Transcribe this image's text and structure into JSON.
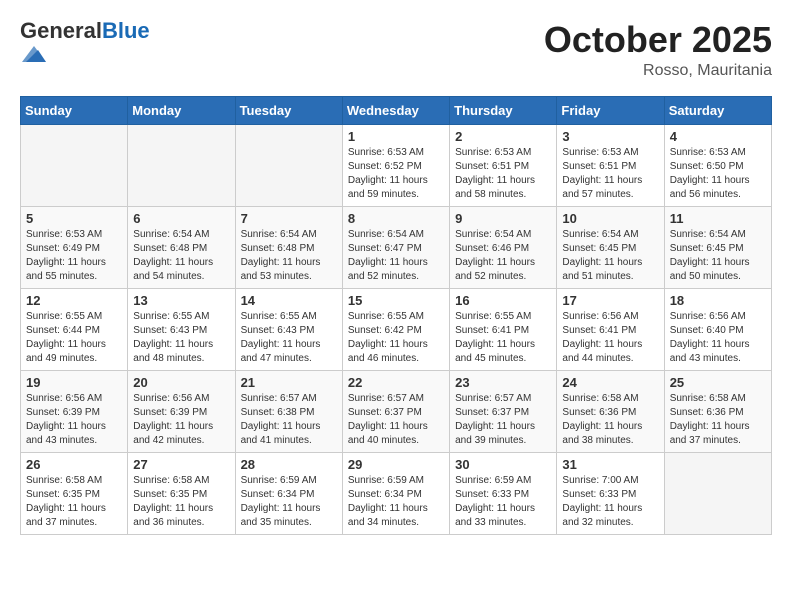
{
  "logo": {
    "general": "General",
    "blue": "Blue"
  },
  "header": {
    "month": "October 2025",
    "location": "Rosso, Mauritania"
  },
  "weekdays": [
    "Sunday",
    "Monday",
    "Tuesday",
    "Wednesday",
    "Thursday",
    "Friday",
    "Saturday"
  ],
  "weeks": [
    [
      {
        "day": "",
        "info": ""
      },
      {
        "day": "",
        "info": ""
      },
      {
        "day": "",
        "info": ""
      },
      {
        "day": "1",
        "info": "Sunrise: 6:53 AM\nSunset: 6:52 PM\nDaylight: 11 hours\nand 59 minutes."
      },
      {
        "day": "2",
        "info": "Sunrise: 6:53 AM\nSunset: 6:51 PM\nDaylight: 11 hours\nand 58 minutes."
      },
      {
        "day": "3",
        "info": "Sunrise: 6:53 AM\nSunset: 6:51 PM\nDaylight: 11 hours\nand 57 minutes."
      },
      {
        "day": "4",
        "info": "Sunrise: 6:53 AM\nSunset: 6:50 PM\nDaylight: 11 hours\nand 56 minutes."
      }
    ],
    [
      {
        "day": "5",
        "info": "Sunrise: 6:53 AM\nSunset: 6:49 PM\nDaylight: 11 hours\nand 55 minutes."
      },
      {
        "day": "6",
        "info": "Sunrise: 6:54 AM\nSunset: 6:48 PM\nDaylight: 11 hours\nand 54 minutes."
      },
      {
        "day": "7",
        "info": "Sunrise: 6:54 AM\nSunset: 6:48 PM\nDaylight: 11 hours\nand 53 minutes."
      },
      {
        "day": "8",
        "info": "Sunrise: 6:54 AM\nSunset: 6:47 PM\nDaylight: 11 hours\nand 52 minutes."
      },
      {
        "day": "9",
        "info": "Sunrise: 6:54 AM\nSunset: 6:46 PM\nDaylight: 11 hours\nand 52 minutes."
      },
      {
        "day": "10",
        "info": "Sunrise: 6:54 AM\nSunset: 6:45 PM\nDaylight: 11 hours\nand 51 minutes."
      },
      {
        "day": "11",
        "info": "Sunrise: 6:54 AM\nSunset: 6:45 PM\nDaylight: 11 hours\nand 50 minutes."
      }
    ],
    [
      {
        "day": "12",
        "info": "Sunrise: 6:55 AM\nSunset: 6:44 PM\nDaylight: 11 hours\nand 49 minutes."
      },
      {
        "day": "13",
        "info": "Sunrise: 6:55 AM\nSunset: 6:43 PM\nDaylight: 11 hours\nand 48 minutes."
      },
      {
        "day": "14",
        "info": "Sunrise: 6:55 AM\nSunset: 6:43 PM\nDaylight: 11 hours\nand 47 minutes."
      },
      {
        "day": "15",
        "info": "Sunrise: 6:55 AM\nSunset: 6:42 PM\nDaylight: 11 hours\nand 46 minutes."
      },
      {
        "day": "16",
        "info": "Sunrise: 6:55 AM\nSunset: 6:41 PM\nDaylight: 11 hours\nand 45 minutes."
      },
      {
        "day": "17",
        "info": "Sunrise: 6:56 AM\nSunset: 6:41 PM\nDaylight: 11 hours\nand 44 minutes."
      },
      {
        "day": "18",
        "info": "Sunrise: 6:56 AM\nSunset: 6:40 PM\nDaylight: 11 hours\nand 43 minutes."
      }
    ],
    [
      {
        "day": "19",
        "info": "Sunrise: 6:56 AM\nSunset: 6:39 PM\nDaylight: 11 hours\nand 43 minutes."
      },
      {
        "day": "20",
        "info": "Sunrise: 6:56 AM\nSunset: 6:39 PM\nDaylight: 11 hours\nand 42 minutes."
      },
      {
        "day": "21",
        "info": "Sunrise: 6:57 AM\nSunset: 6:38 PM\nDaylight: 11 hours\nand 41 minutes."
      },
      {
        "day": "22",
        "info": "Sunrise: 6:57 AM\nSunset: 6:37 PM\nDaylight: 11 hours\nand 40 minutes."
      },
      {
        "day": "23",
        "info": "Sunrise: 6:57 AM\nSunset: 6:37 PM\nDaylight: 11 hours\nand 39 minutes."
      },
      {
        "day": "24",
        "info": "Sunrise: 6:58 AM\nSunset: 6:36 PM\nDaylight: 11 hours\nand 38 minutes."
      },
      {
        "day": "25",
        "info": "Sunrise: 6:58 AM\nSunset: 6:36 PM\nDaylight: 11 hours\nand 37 minutes."
      }
    ],
    [
      {
        "day": "26",
        "info": "Sunrise: 6:58 AM\nSunset: 6:35 PM\nDaylight: 11 hours\nand 37 minutes."
      },
      {
        "day": "27",
        "info": "Sunrise: 6:58 AM\nSunset: 6:35 PM\nDaylight: 11 hours\nand 36 minutes."
      },
      {
        "day": "28",
        "info": "Sunrise: 6:59 AM\nSunset: 6:34 PM\nDaylight: 11 hours\nand 35 minutes."
      },
      {
        "day": "29",
        "info": "Sunrise: 6:59 AM\nSunset: 6:34 PM\nDaylight: 11 hours\nand 34 minutes."
      },
      {
        "day": "30",
        "info": "Sunrise: 6:59 AM\nSunset: 6:33 PM\nDaylight: 11 hours\nand 33 minutes."
      },
      {
        "day": "31",
        "info": "Sunrise: 7:00 AM\nSunset: 6:33 PM\nDaylight: 11 hours\nand 32 minutes."
      },
      {
        "day": "",
        "info": ""
      }
    ]
  ]
}
